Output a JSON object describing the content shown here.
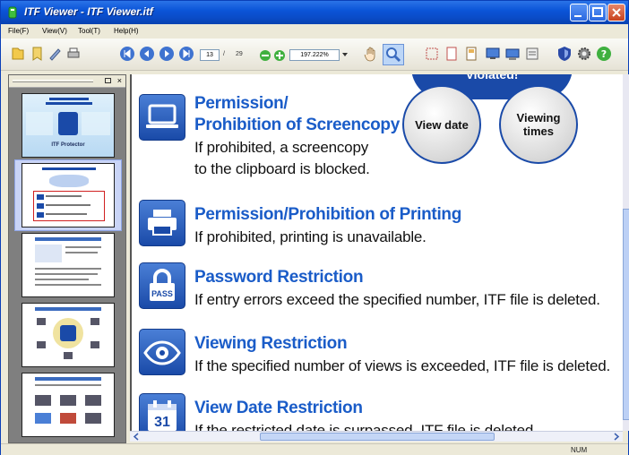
{
  "window": {
    "title": "ITF Viewer - ITF Viewer.itf"
  },
  "menu": [
    "File(F)",
    "View(V)",
    "Tool(T)",
    "Help(H)"
  ],
  "toolbar": {
    "current_page": "13",
    "separator": "/",
    "total_pages": "29",
    "zoom": "197.222%"
  },
  "sidebar": {
    "close_symbol": "×",
    "thumb1_caption": "ITF Protector"
  },
  "main": {
    "banner_text": "Violated!",
    "circle_view_date": "View date",
    "circle_viewing_times": "Viewing times",
    "features": [
      {
        "icon": "monitor-icon",
        "title_line1": "Permission/",
        "title_line2": "Prohibition of Screencopy",
        "desc_line1": "If prohibited, a screencopy",
        "desc_line2": "to the clipboard is blocked."
      },
      {
        "icon": "printer-icon",
        "title": "Permission/Prohibition of Printing",
        "desc": "If prohibited, printing is unavailable."
      },
      {
        "icon": "lock-icon",
        "icon_label": "PASS",
        "title": "Password Restriction",
        "desc": "If entry errors exceed the specified number, ITF file is deleted."
      },
      {
        "icon": "eye-icon",
        "title": "Viewing Restriction",
        "desc": "If the specified number of views is exceeded, ITF file is deleted."
      },
      {
        "icon": "calendar-icon",
        "icon_label": "31",
        "title": "View Date Restriction",
        "desc": "If the restricted date is surpassed, ITF file is deleted."
      }
    ]
  },
  "status": {
    "num": "NUM"
  },
  "colors": {
    "title_blue": "#1a5cc8",
    "icon_blue": "#1a4aa8",
    "xp_titlebar": "#0b55d8"
  }
}
